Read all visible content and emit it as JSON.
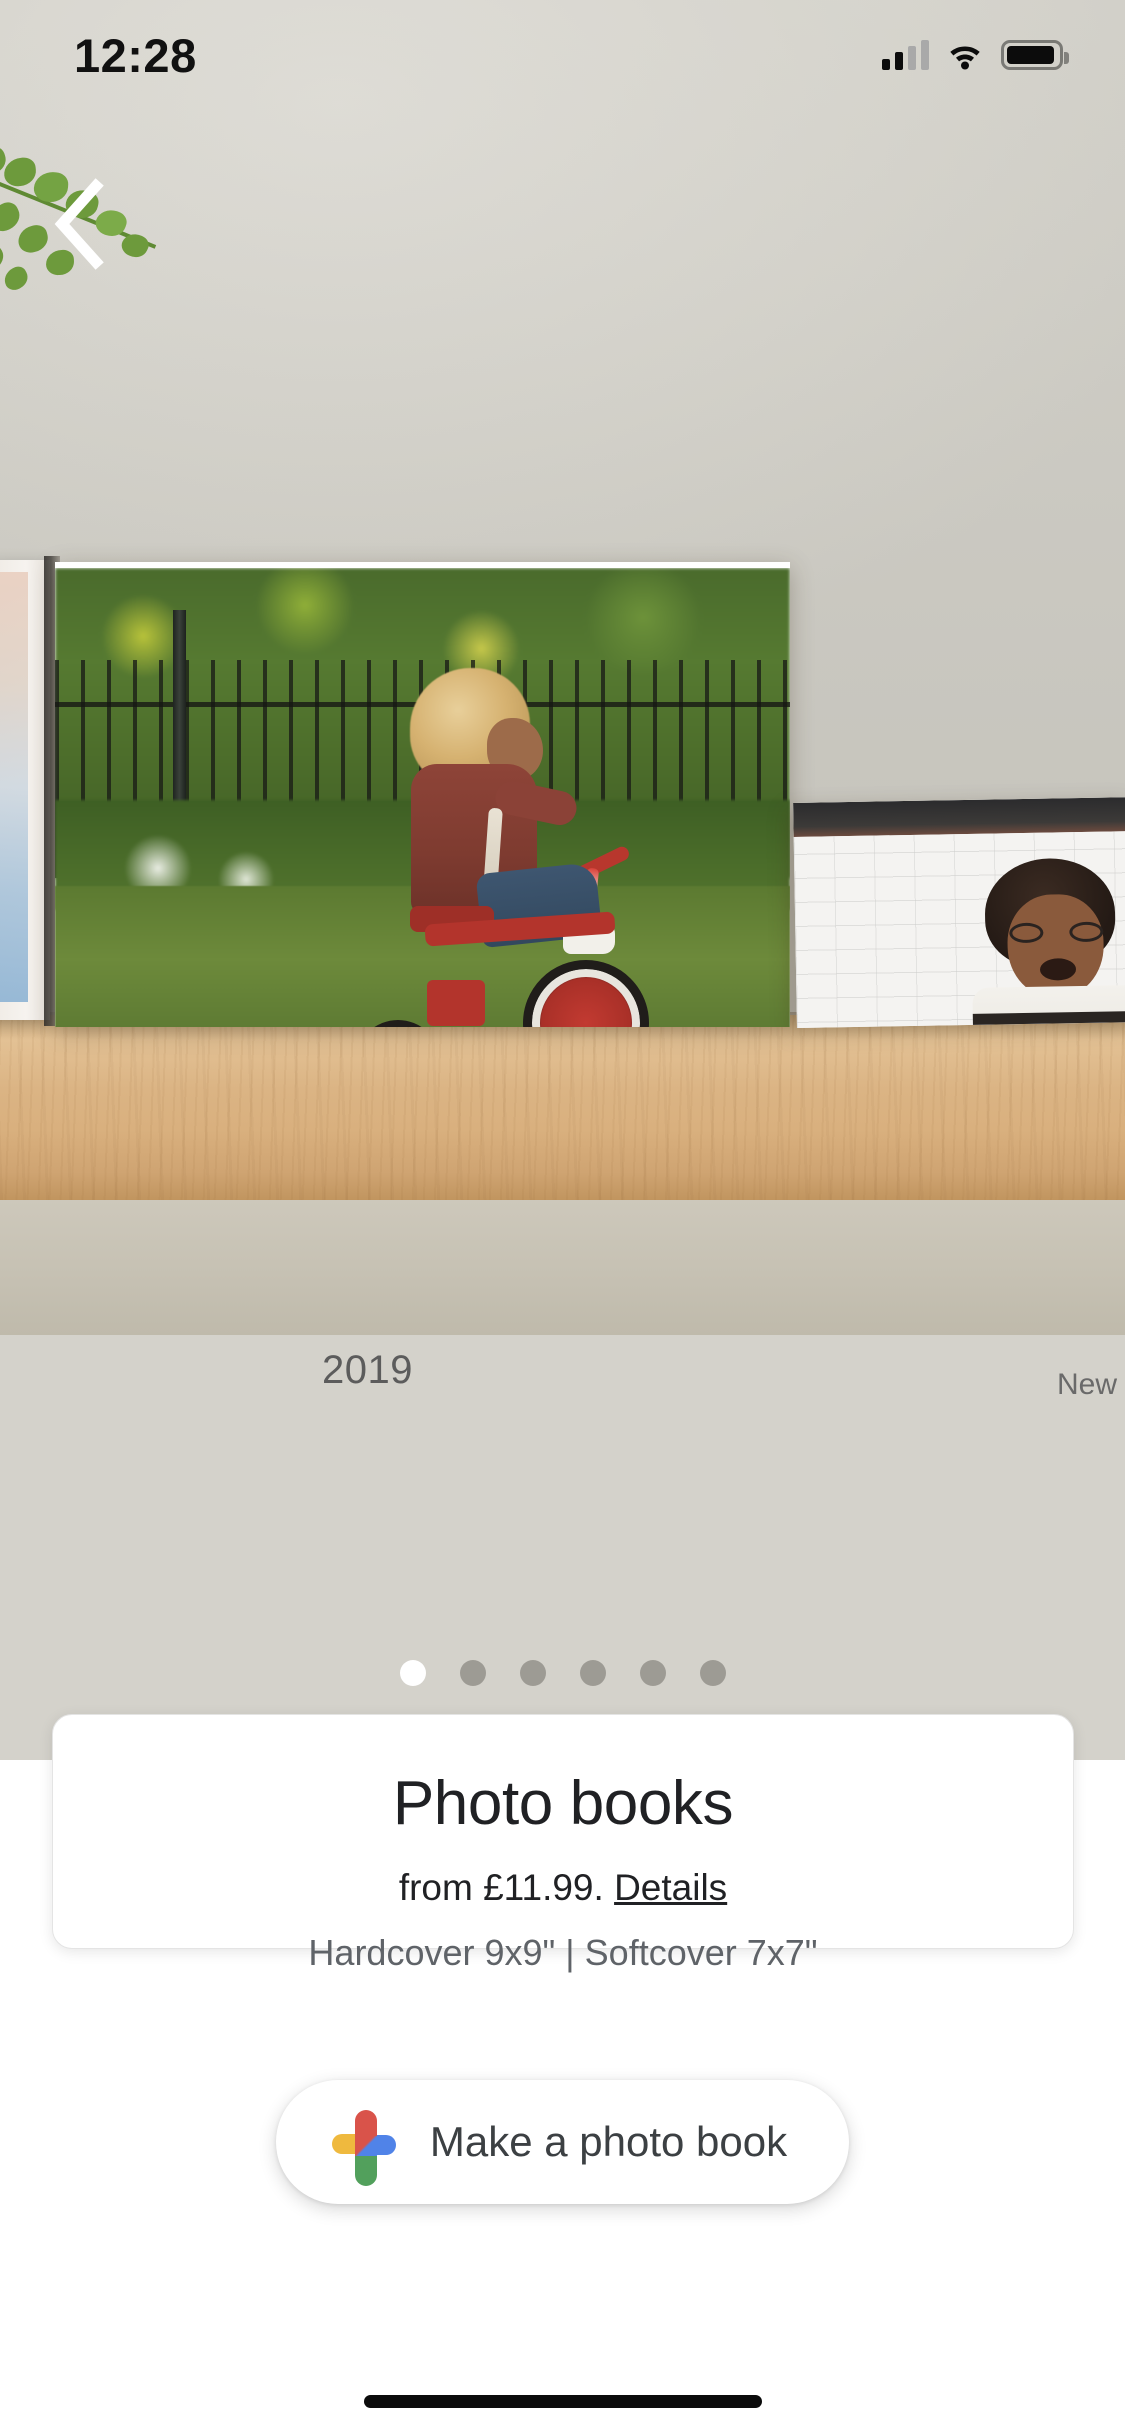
{
  "status_bar": {
    "time": "12:28",
    "signal_icon": "cellular-signal-icon",
    "signal_bars_filled": 2,
    "signal_bars_total": 4,
    "wifi_icon": "wifi-icon",
    "battery_icon": "battery-icon",
    "battery_level_percent": 93
  },
  "nav": {
    "back_icon": "chevron-left-icon",
    "back_label": "Back"
  },
  "hero": {
    "scene_description": "Photo books displayed on a wooden shelf against a light wall with a fern leaf",
    "book_front_caption": "2019",
    "book_back_caption": "New",
    "fern_icon": "fern-leaf-decoration"
  },
  "carousel": {
    "total_dots": 6,
    "active_index": 0
  },
  "info_card": {
    "title": "Photo books",
    "price_prefix": "from £11.99.",
    "details_link": "Details",
    "sizes": "Hardcover 9x9\" | Softcover 7x7\""
  },
  "cta": {
    "label": "Make a photo book",
    "logo_icon": "google-photos-icon"
  },
  "system": {
    "home_indicator": "home-indicator"
  },
  "colors": {
    "google_red": "#d9534a",
    "google_yellow": "#efb93e",
    "google_blue": "#5083e8",
    "google_green": "#52a05c",
    "text_primary": "#202124",
    "text_secondary": "#5f6368",
    "card_background": "#ffffff"
  }
}
